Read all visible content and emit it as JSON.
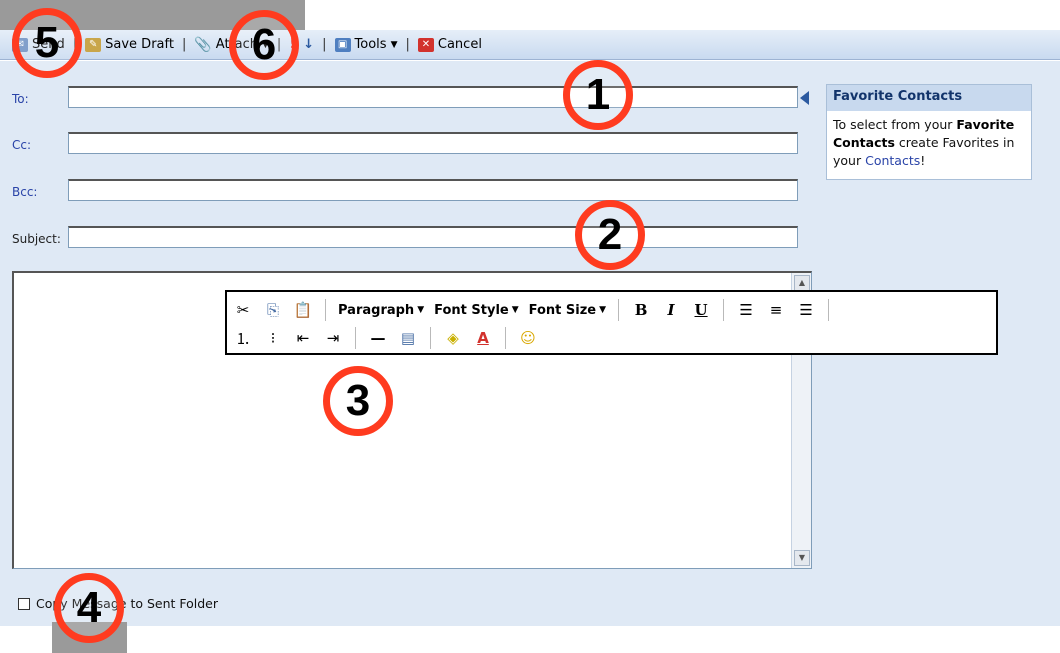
{
  "toolbar": {
    "send": "Send",
    "save_draft": "Save Draft",
    "attach": "Attach",
    "priority_high": "!",
    "priority_low": "↓",
    "tools": "Tools",
    "cancel": "Cancel"
  },
  "fields": {
    "to": "To:",
    "cc": "Cc:",
    "bcc": "Bcc:",
    "subject": "Subject:"
  },
  "favorites": {
    "title": "Favorite Contacts",
    "text_1": "To select from your ",
    "text_bold": "Favorite Contacts",
    "text_2": " create Favorites in your ",
    "link": "Contacts",
    "text_3": "!"
  },
  "format_toolbar": {
    "paragraph": "Paragraph",
    "font_style": "Font Style",
    "font_size": "Font Size",
    "bold": "B",
    "italic": "I",
    "underline": "U"
  },
  "copy_to_sent": "Copy Message to Sent Folder",
  "callouts": [
    "1",
    "2",
    "3",
    "4",
    "5",
    "6"
  ],
  "colors": {
    "callout": "#ff3b1f",
    "link": "#2a44a8",
    "header": "#c8d9ee"
  }
}
